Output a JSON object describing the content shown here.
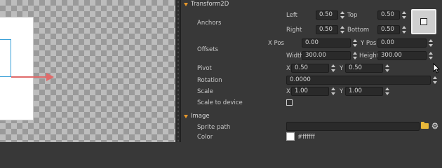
{
  "transform2d": {
    "section_title": "Transform2D",
    "anchors": {
      "label": "Anchors",
      "left_label": "Left",
      "left_value": "0.50",
      "top_label": "Top",
      "top_value": "0.50",
      "right_label": "Right",
      "right_value": "0.50",
      "bottom_label": "Bottom",
      "bottom_value": "0.50"
    },
    "offsets": {
      "label": "Offsets",
      "xpos_label": "X Pos",
      "xpos_value": "0.00",
      "ypos_label": "Y Pos",
      "ypos_value": "0.00",
      "width_label": "Width",
      "width_value": "300.00",
      "height_label": "Height",
      "height_value": "300.00"
    },
    "pivot": {
      "label": "Pivot",
      "x_label": "X",
      "x_value": "0.50",
      "y_label": "Y",
      "y_value": "0.50"
    },
    "rotation": {
      "label": "Rotation",
      "value": "0.0000"
    },
    "scale": {
      "label": "Scale",
      "x_label": "X",
      "x_value": "1.00",
      "y_label": "Y",
      "y_value": "1.00"
    },
    "scale_to_device": {
      "label": "Scale to device",
      "checked": false
    }
  },
  "image": {
    "section_title": "Image",
    "sprite_path": {
      "label": "Sprite path",
      "value": ""
    },
    "color": {
      "label": "Color",
      "value": "#ffffff"
    }
  },
  "icons": {
    "section_toggle": "triangle-down-icon",
    "anchor_preset": "anchor-preset-icon",
    "folder": "folder-icon",
    "gear": "gear-icon",
    "cursor": "mouse-cursor-icon"
  },
  "colors": {
    "accent_orange": "#e8992a",
    "axis_red": "#e06a6a",
    "selection_blue": "#3aa0d8",
    "panel_bg": "#383838",
    "field_bg": "#2a2a2a"
  }
}
